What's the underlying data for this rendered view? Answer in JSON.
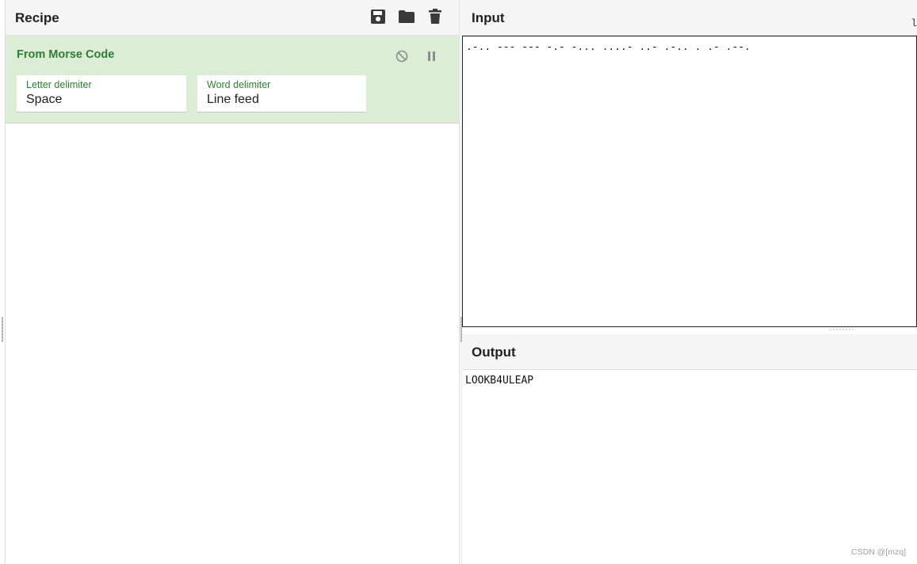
{
  "recipe": {
    "title": "Recipe",
    "icons": [
      "save-icon",
      "folder-icon",
      "trash-icon"
    ],
    "operation": {
      "name": "From Morse Code",
      "controls": [
        "disable-icon",
        "pause-icon"
      ],
      "fields": [
        {
          "label": "Letter delimiter",
          "value": "Space"
        },
        {
          "label": "Word delimiter",
          "value": "Line feed"
        }
      ]
    }
  },
  "input": {
    "title": "Input",
    "value": ".-.. --- --- -.- -... ....- ..- .-.. . .- .--.",
    "edge_glyph": "l"
  },
  "output": {
    "title": "Output",
    "value": "LOOKB4ULEAP"
  },
  "watermark": "CSDN @[mzq]",
  "colors": {
    "operation_bg": "#dcedd6",
    "operation_text": "#2f7d32",
    "header_bg": "#f5f5f5"
  }
}
